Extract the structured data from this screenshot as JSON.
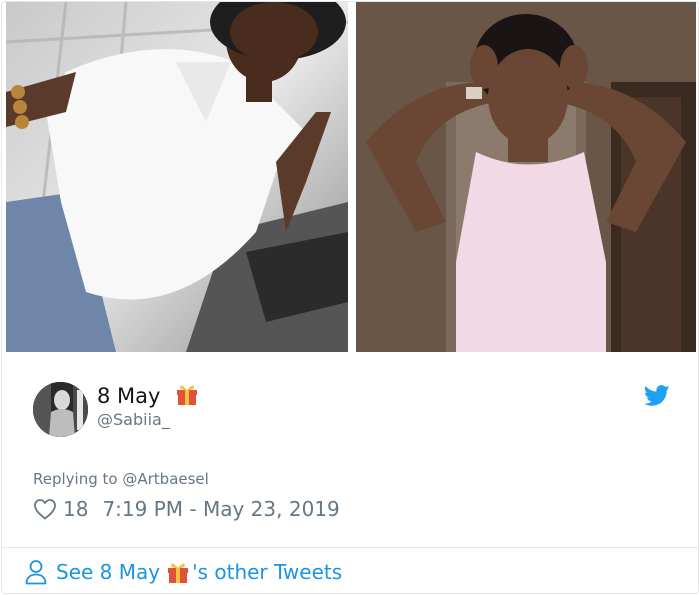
{
  "tweet": {
    "display_name": "8 May",
    "gift_emoji": "🎁",
    "handle": "@Sabiia_",
    "replying_prefix": "Replying to",
    "replying_handle": "@Artbaesel",
    "likes": "18",
    "timestamp": "7:19 PM - May 23, 2019"
  },
  "footer": {
    "see_prefix": "See 8 May",
    "see_suffix": "'s other Tweets"
  },
  "icons": {
    "brand": "twitter-bird-icon",
    "like": "heart-icon",
    "profile": "person-icon"
  },
  "colors": {
    "accent": "#1b95e0",
    "twitter_blue": "#1da1f2",
    "muted": "#657786",
    "text": "#14171a",
    "border": "#e1e8ed",
    "gift_red": "#e0533a",
    "gift_ribbon": "#f5c242"
  }
}
